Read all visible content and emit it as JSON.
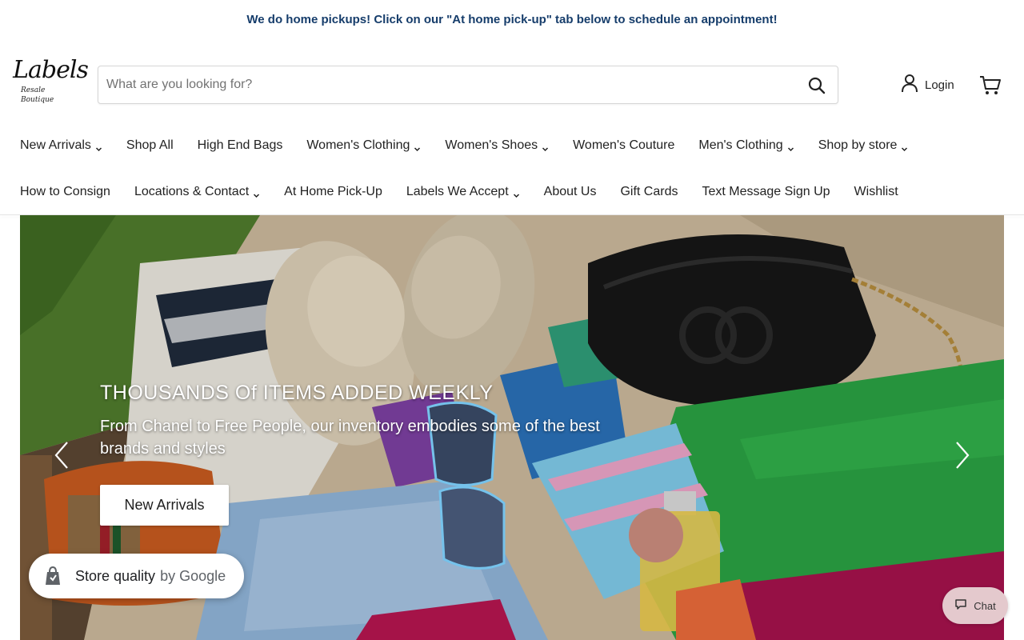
{
  "announcement": "We do home pickups! Click on our \"At home pick-up\" tab below to schedule an appointment!",
  "logo": {
    "brand": "Labels",
    "sub": "Resale Boutique"
  },
  "search": {
    "placeholder": "What are you looking for?",
    "value": ""
  },
  "account": {
    "login_label": "Login"
  },
  "nav": {
    "row1": [
      {
        "label": "New Arrivals",
        "dropdown": true
      },
      {
        "label": "Shop All",
        "dropdown": false
      },
      {
        "label": "High End Bags",
        "dropdown": false
      },
      {
        "label": "Women's Clothing",
        "dropdown": true
      },
      {
        "label": "Women's Shoes",
        "dropdown": true
      },
      {
        "label": "Women's Couture",
        "dropdown": false
      },
      {
        "label": "Men's Clothing",
        "dropdown": true
      },
      {
        "label": "Shop by store",
        "dropdown": true
      }
    ],
    "row2": [
      {
        "label": "How to Consign",
        "dropdown": false
      },
      {
        "label": "Locations & Contact",
        "dropdown": true
      },
      {
        "label": "At Home Pick-Up",
        "dropdown": false
      },
      {
        "label": "Labels We Accept",
        "dropdown": true
      },
      {
        "label": "About Us",
        "dropdown": false
      },
      {
        "label": "Gift Cards",
        "dropdown": false
      },
      {
        "label": "Text Message Sign Up",
        "dropdown": false
      },
      {
        "label": "Wishlist",
        "dropdown": false
      }
    ]
  },
  "hero": {
    "title": "THOUSANDS Of ITEMS ADDED WEEKLY",
    "subtitle": "From Chanel to Free People, our inventory embodies some of the best brands and styles",
    "button_label": "New Arrivals"
  },
  "store_quality": {
    "label": "Store quality",
    "by": "by Google"
  },
  "chat": {
    "label": "Chat"
  },
  "colors": {
    "announcement": "#163d6b",
    "chat_bg": "#e4c9cd"
  }
}
